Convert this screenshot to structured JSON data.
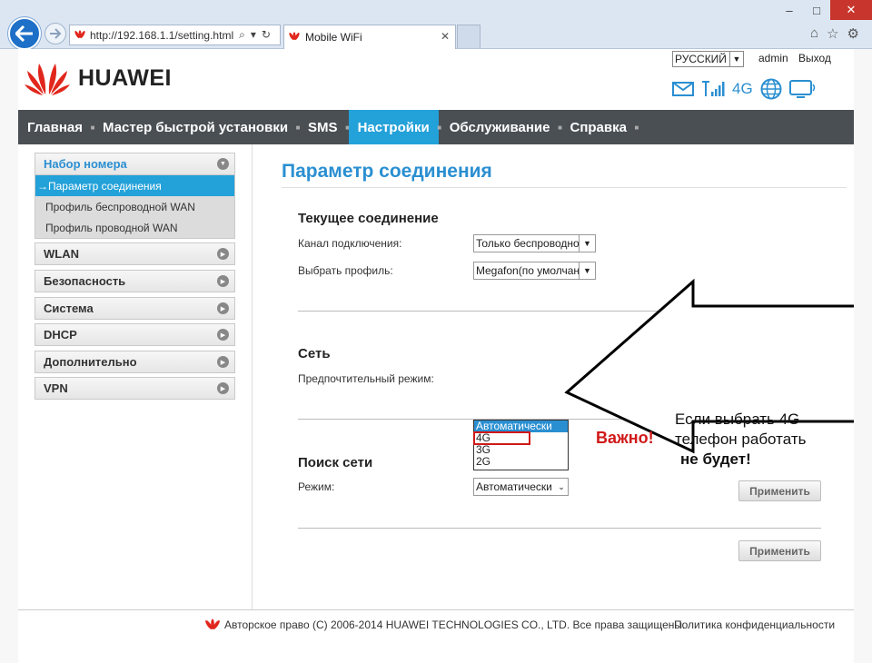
{
  "browser": {
    "address": "http://192.168.1.1/setting.html",
    "tab_title": "Mobile WiFi",
    "controls": {
      "minimize": "–",
      "maximize": "□",
      "close": "✕"
    }
  },
  "header": {
    "language": "РУССКИЙ",
    "user": "admin",
    "logout": "Выход",
    "brand": "HUAWEI",
    "network_type": "4G"
  },
  "nav": {
    "items": [
      "Главная",
      "Мастер быстрой установки",
      "SMS",
      "Настройки",
      "Обслуживание",
      "Справка"
    ],
    "active": "Настройки"
  },
  "sidebar": {
    "open_group": "Набор номера",
    "sub_items": [
      "→Параметр соединения",
      "Профиль беспроводной WAN",
      "Профиль проводной WAN"
    ],
    "groups": [
      "WLAN",
      "Безопасность",
      "Система",
      "DHCP",
      "Дополнительно",
      "VPN"
    ]
  },
  "main": {
    "title": "Параметр соединения",
    "current_connection": {
      "heading": "Текущее соединение",
      "channel_label": "Канал подключения:",
      "channel_value": "Только беспроводно",
      "profile_label": "Выбрать профиль:",
      "profile_value": "Megafon(по умолчані"
    },
    "network": {
      "heading": "Сеть",
      "mode_label": "Предпочтительный режим:",
      "options": [
        "Автоматически",
        "4G",
        "3G",
        "2G"
      ],
      "selected": "Автоматически"
    },
    "search": {
      "heading": "Поиск сети",
      "mode_label": "Режим:",
      "mode_value": "Автоматически"
    },
    "apply_label": "Применить"
  },
  "annotation": {
    "important": "Важно!",
    "line1": "Если выбрать 4G",
    "line2": "телефон работать",
    "line3": "не будет!"
  },
  "footer": {
    "copyright": "Авторское право (C) 2006-2014 HUAWEI TECHNOLOGIES CO., LTD. Все права защищены.",
    "privacy": "Политика конфиденциальности"
  },
  "colors": {
    "accent": "#23a1d9",
    "nav_bg": "#4a4f54",
    "brand_red": "#e1261c",
    "warning_red": "#d01818"
  }
}
